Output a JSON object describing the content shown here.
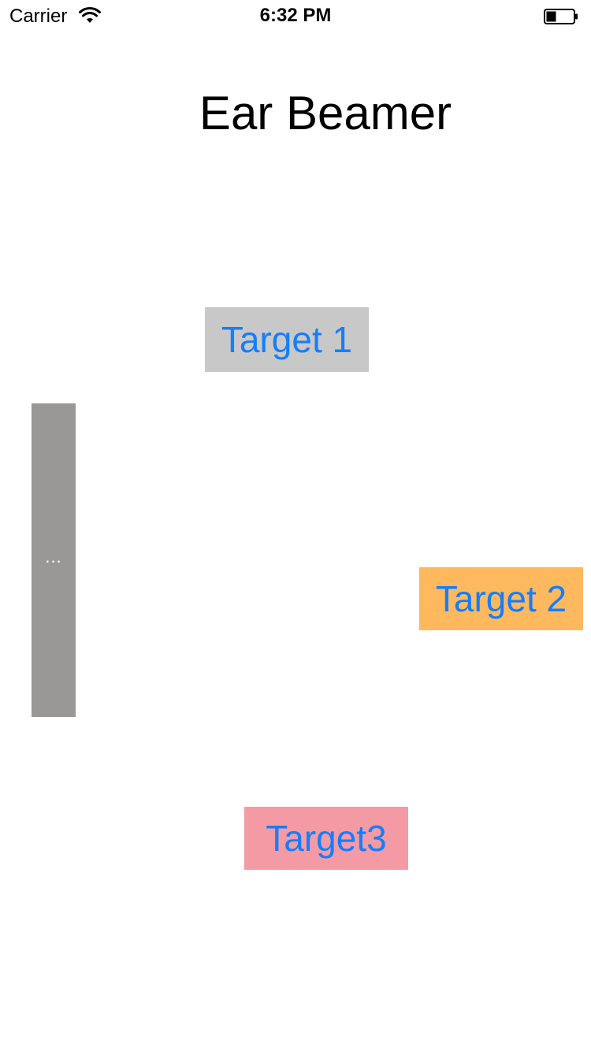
{
  "status_bar": {
    "carrier": "Carrier",
    "time": "6:32 PM",
    "wifi_icon": "wifi-icon",
    "battery_icon": "battery-icon",
    "battery_level": 0.35
  },
  "title": "Ear Beamer",
  "targets": [
    {
      "label": "Target 1",
      "color": "#C8C8C8"
    },
    {
      "label": "Target 2",
      "color": "#FEB95F"
    },
    {
      "label": "Target3",
      "color": "#F49AA5"
    }
  ],
  "side_handle": {
    "label": "...",
    "color": "#999896"
  },
  "colors": {
    "button_text": "#147EFB",
    "background": "#FFFFFF"
  }
}
